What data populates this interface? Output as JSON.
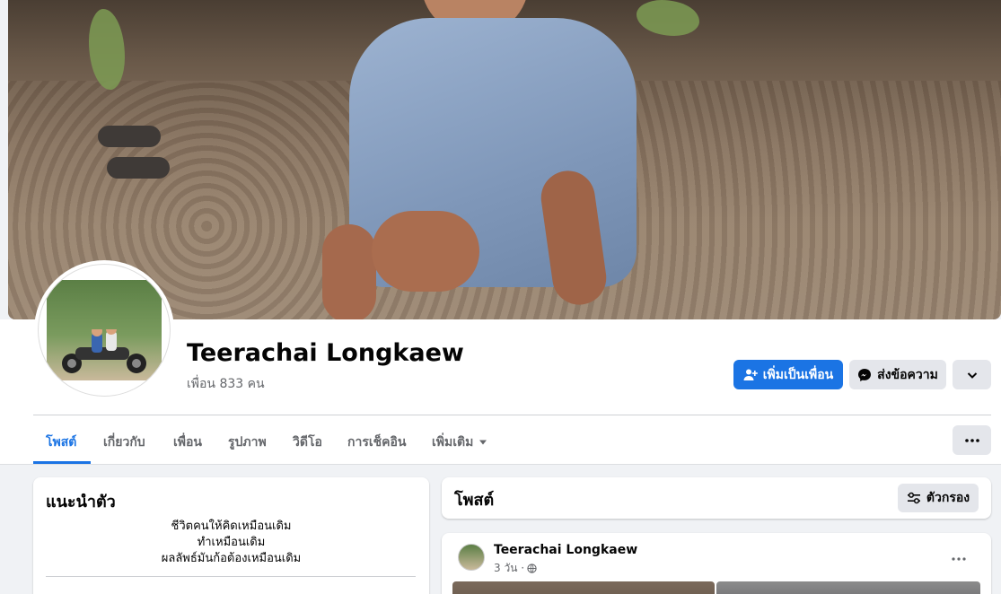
{
  "profile": {
    "name": "Teerachai Longkaew",
    "friends_text": "เพื่อน 833 คน"
  },
  "actions": {
    "add_friend": "เพิ่มเป็นเพื่อน",
    "message": "ส่งข้อความ"
  },
  "tabs": [
    {
      "label": "โพสต์",
      "active": true
    },
    {
      "label": "เกี่ยวกับ",
      "active": false
    },
    {
      "label": "เพื่อน",
      "active": false
    },
    {
      "label": "รูปภาพ",
      "active": false
    },
    {
      "label": "วิดีโอ",
      "active": false
    },
    {
      "label": "การเช็คอิน",
      "active": false
    },
    {
      "label": "เพิ่มเติม",
      "active": false
    }
  ],
  "intro": {
    "title": "แนะนำตัว",
    "bio_lines": [
      "ชีวิตคนให้คิดเหมือนเดิม",
      "ทำเหมือนเดิม",
      "ผลลัพธ์มันก้อต้องเหมือนเดิม"
    ]
  },
  "posts": {
    "title": "โพสต์",
    "filter_label": "ตัวกรอง",
    "first_post": {
      "author": "Teerachai Longkaew",
      "time": "3 วัน ·"
    }
  },
  "colors": {
    "accent": "#1b74e4",
    "background": "#f0f2f5",
    "secondary_button": "#e4e6eb"
  },
  "icons": {
    "add_friend": "person-plus-icon",
    "message": "messenger-icon",
    "dropdown": "chevron-down-icon",
    "more": "more-dots-icon",
    "filter": "sliders-icon",
    "privacy": "globe-icon"
  }
}
